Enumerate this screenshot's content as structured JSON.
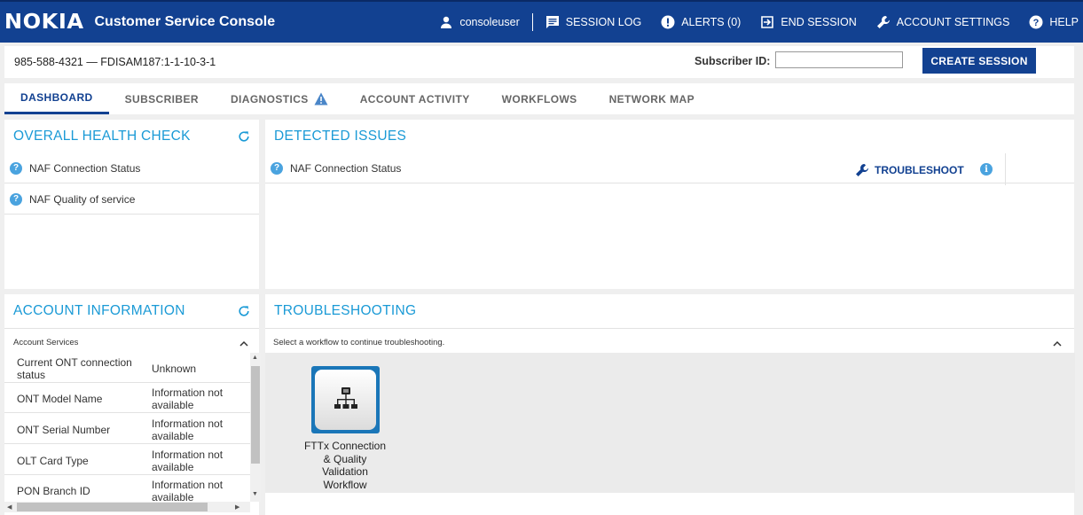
{
  "header": {
    "logo_text": "NOKIA",
    "app_title": "Customer Service Console",
    "username": "consoleuser",
    "nav": {
      "session_log": "SESSION LOG",
      "alerts": "ALERTS (0)",
      "end_session": "END SESSION",
      "account_settings": "ACCOUNT SETTINGS",
      "help": "HELP"
    },
    "brand_color": "#124191"
  },
  "session": {
    "subscriber_summary": "985-588-4321 — FDISAM187:1-1-10-3-1",
    "subscriber_id_label": "Subscriber ID:",
    "subscriber_id_value": "",
    "create_session_label": "CREATE SESSION"
  },
  "tabs": [
    {
      "label": "DASHBOARD",
      "active": true
    },
    {
      "label": "SUBSCRIBER"
    },
    {
      "label": "DIAGNOSTICS",
      "icon": "warning-icon"
    },
    {
      "label": "ACCOUNT ACTIVITY"
    },
    {
      "label": "WORKFLOWS"
    },
    {
      "label": "NETWORK MAP"
    }
  ],
  "health_check": {
    "title": "OVERALL HEALTH CHECK",
    "items": [
      {
        "label": "NAF Connection Status",
        "icon": "question-icon"
      },
      {
        "label": "NAF Quality of service",
        "icon": "question-icon"
      }
    ]
  },
  "detected_issues": {
    "title": "DETECTED ISSUES",
    "items": [
      {
        "label": "NAF Connection Status",
        "action": "TROUBLESHOOT",
        "icon": "question-icon"
      }
    ]
  },
  "account_info": {
    "title": "ACCOUNT INFORMATION",
    "section": "Account Services",
    "rows": [
      {
        "key": "Current ONT connection status",
        "value": "Unknown"
      },
      {
        "key": "ONT Model Name",
        "value": "Information not available"
      },
      {
        "key": "ONT Serial Number",
        "value": "Information not available"
      },
      {
        "key": "OLT Card Type",
        "value": "Information not available"
      },
      {
        "key": "PON Branch ID",
        "value": "Information not available"
      }
    ]
  },
  "troubleshooting": {
    "title": "TROUBLESHOOTING",
    "instruction": "Select a workflow to continue troubleshooting.",
    "workflows": [
      {
        "label": "FTTx Connection & Quality Validation Workflow",
        "icon": "workflow-hierarchy-icon"
      }
    ]
  },
  "colors": {
    "accent_title": "#1a9ad6",
    "info_icon": "#4aa3df",
    "workflow_tile": "#1a76b8"
  }
}
